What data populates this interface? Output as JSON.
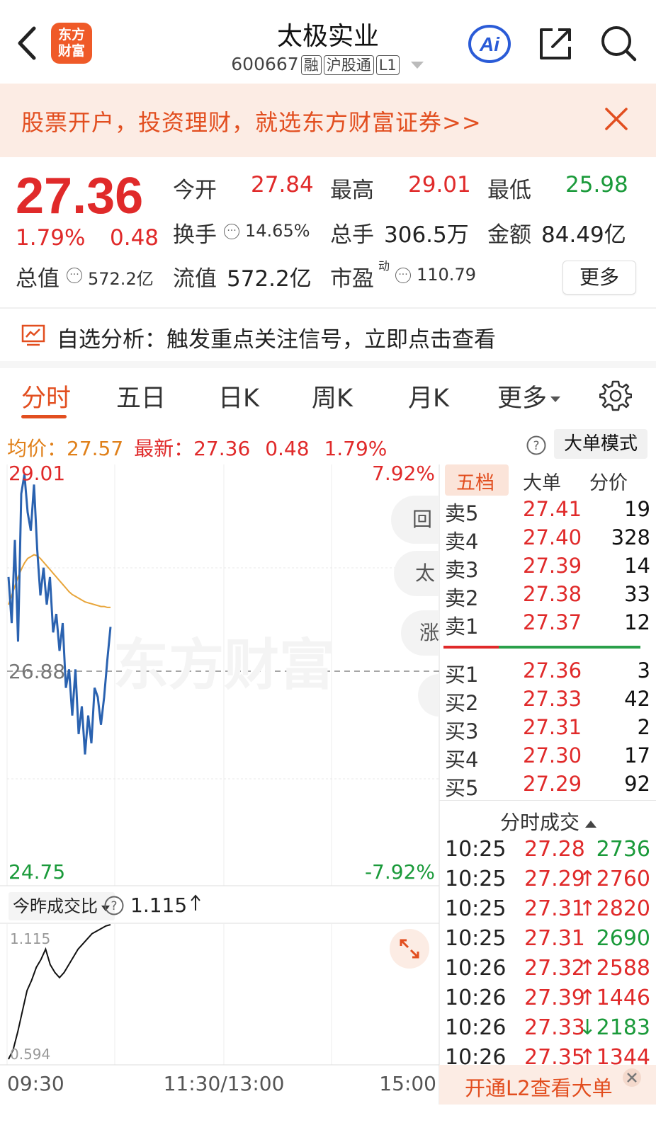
{
  "header": {
    "stock_name": "太极实业",
    "code": "600667",
    "tags": [
      "融",
      "沪股通",
      "L1"
    ],
    "logo_line1": "东方",
    "logo_line2": "财富",
    "ai_label": "Ai"
  },
  "banner": {
    "text": "股票开户，投资理财，就选东方财富证券>>"
  },
  "quote": {
    "price": "27.36",
    "change_pct": "1.79%",
    "change": "0.48",
    "open_label": "今开",
    "open": "27.84",
    "high_label": "最高",
    "high": "29.01",
    "low_label": "最低",
    "low": "25.98",
    "turnover_label": "换手",
    "turnover": "14.65%",
    "volume_label": "总手",
    "volume": "306.5万",
    "amount_label": "金额",
    "amount": "84.49亿",
    "total_cap_label": "总值",
    "total_cap": "572.2亿",
    "float_cap_label": "流值",
    "float_cap": "572.2亿",
    "pe_label": "市盈",
    "pe_sup": "动",
    "pe": "110.79",
    "more_label": "更多"
  },
  "analysis": {
    "text": "自选分析：触发重点关注信号，立即点击查看"
  },
  "tabs": [
    "分时",
    "五日",
    "日K",
    "周K",
    "月K",
    "更多"
  ],
  "price_line": {
    "avg_label": "均价：",
    "avg": "27.57",
    "last_label": "最新：",
    "last": "27.36",
    "chg": "0.48",
    "pct": "1.79%",
    "mode_button": "大单模式"
  },
  "chart": {
    "y_top": "29.01",
    "y_mid": "26.88",
    "y_bottom": "24.75",
    "pct_top": "7.92%",
    "pct_bottom": "-7.92%",
    "watermark": "东方财富",
    "float_buttons": [
      "回",
      "太",
      "涨"
    ],
    "sub_label": "今昨成交比",
    "sub_value": "1.115",
    "sub_top": "1.115",
    "sub_bottom": "0.594",
    "x_labels": [
      "09:30",
      "11:30/13:00",
      "15:00"
    ]
  },
  "chart_data": {
    "type": "line",
    "series": [
      {
        "name": "price",
        "color": "#2a62b0",
        "values": [
          27.9,
          27.4,
          28.3,
          27.2,
          28.8,
          29.01,
          28.6,
          28.4,
          28.9,
          28.2,
          27.7,
          28.0,
          27.6,
          27.9,
          27.3,
          27.5,
          27.1,
          27.4,
          26.7,
          26.9,
          26.4,
          26.9,
          26.2,
          26.5,
          25.98,
          26.4,
          26.1,
          26.7,
          26.6,
          26.3,
          26.6,
          27.0,
          27.36
        ]
      },
      {
        "name": "avg",
        "color": "#e8a53a",
        "values": [
          27.6,
          27.7,
          27.8,
          27.9,
          27.98,
          28.05,
          28.1,
          28.12,
          28.14,
          28.13,
          28.1,
          28.06,
          28.02,
          27.98,
          27.94,
          27.9,
          27.86,
          27.82,
          27.78,
          27.74,
          27.71,
          27.69,
          27.67,
          27.65,
          27.63,
          27.62,
          27.61,
          27.6,
          27.59,
          27.58,
          27.58,
          27.57,
          27.57
        ]
      }
    ],
    "ylim": [
      24.75,
      29.01
    ],
    "prev_close": 26.88,
    "sub_series": {
      "name": "ratio",
      "values": [
        0.594,
        0.63,
        0.7,
        0.78,
        0.86,
        0.9,
        0.95,
        0.98,
        1.02,
        0.96,
        0.93,
        0.91,
        0.93,
        0.96,
        0.99,
        1.02,
        1.04,
        1.06,
        1.08,
        1.09,
        1.1,
        1.11,
        1.115
      ],
      "ylim": [
        0.594,
        1.115
      ]
    }
  },
  "order_book": {
    "tabs": [
      "五档",
      "大单",
      "分价"
    ],
    "asks": [
      {
        "label": "卖5",
        "price": "27.41",
        "vol": "19"
      },
      {
        "label": "卖4",
        "price": "27.40",
        "vol": "328"
      },
      {
        "label": "卖3",
        "price": "27.39",
        "vol": "14"
      },
      {
        "label": "卖2",
        "price": "27.38",
        "vol": "33"
      },
      {
        "label": "卖1",
        "price": "27.37",
        "vol": "12"
      }
    ],
    "bids": [
      {
        "label": "买1",
        "price": "27.36",
        "vol": "3"
      },
      {
        "label": "买2",
        "price": "27.33",
        "vol": "42"
      },
      {
        "label": "买3",
        "price": "27.31",
        "vol": "2"
      },
      {
        "label": "买4",
        "price": "27.30",
        "vol": "17"
      },
      {
        "label": "买5",
        "price": "27.29",
        "vol": "92"
      }
    ]
  },
  "trades": {
    "title": "分时成交",
    "rows": [
      {
        "time": "10:25",
        "price": "27.28",
        "vol": "2736",
        "dir": "sell"
      },
      {
        "time": "10:25",
        "price": "27.29",
        "vol": "↑2760",
        "dir": "buy"
      },
      {
        "time": "10:25",
        "price": "27.31",
        "vol": "↑2820",
        "dir": "buy"
      },
      {
        "time": "10:25",
        "price": "27.31",
        "vol": "2690",
        "dir": "sell"
      },
      {
        "time": "10:26",
        "price": "27.32",
        "vol": "↑2588",
        "dir": "buy"
      },
      {
        "time": "10:26",
        "price": "27.39",
        "vol": "↑1446",
        "dir": "buy"
      },
      {
        "time": "10:26",
        "price": "27.33",
        "vol": "↓2183",
        "dir": "sellbig"
      },
      {
        "time": "10:26",
        "price": "27.35",
        "vol": "↑1344",
        "dir": "buy"
      }
    ]
  },
  "l2": {
    "text": "开通L2查看大单"
  }
}
